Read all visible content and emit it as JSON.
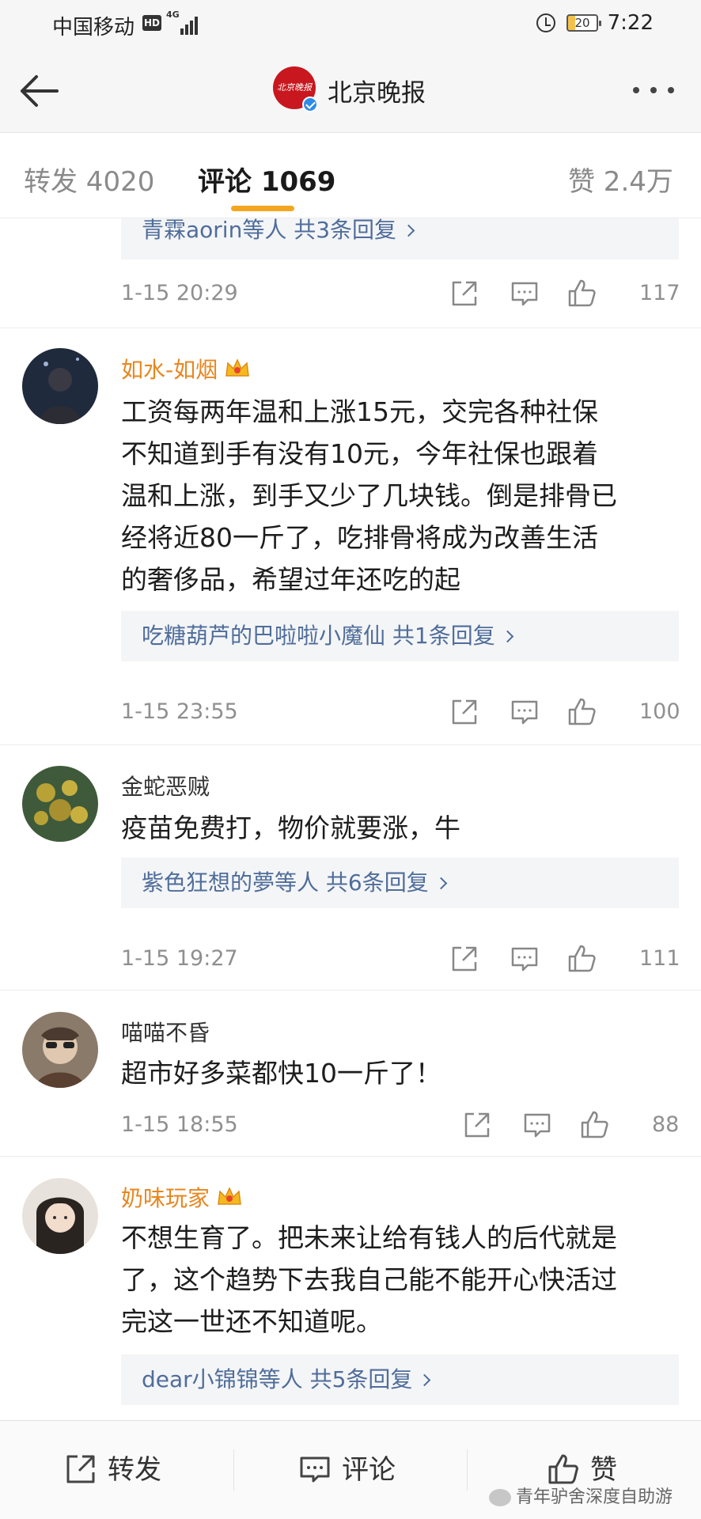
{
  "status_bar": {
    "carrier": "中国移动",
    "hd": "HD",
    "network": "4G",
    "battery": "20",
    "time": "7:22"
  },
  "header": {
    "logo_text": "北京晚报",
    "account_name": "北京晚报",
    "more_icon": "more-dots-icon",
    "back_icon": "arrow-left-icon"
  },
  "tabs": {
    "repost": "转发 4020",
    "comments": "评论 1069",
    "likes": "赞 2.4万"
  },
  "colors": {
    "accent": "#f4a621",
    "link": "#4f6d9a",
    "vip_name": "#e8861e",
    "brand_red": "#c8171e"
  },
  "feed": {
    "top": {
      "reply_summary": "青霖aorin等人  共3条回复",
      "time": "1-15 20:29",
      "likes": "117"
    },
    "comments": [
      {
        "username": "如水-如烟",
        "vip": true,
        "text": "工资每两年温和上涨15元，交完各种社保\n不知道到手有没有10元，今年社保也跟着\n温和上涨，到手又少了几块钱。倒是排骨已\n经将近80一斤了，吃排骨将成为改善生活\n的奢侈品，希望过年还吃的起",
        "reply_summary": "吃糖葫芦的巴啦啦小魔仙  共1条回复",
        "time": "1-15 23:55",
        "likes": "100"
      },
      {
        "username": "金蛇恶贼",
        "vip": false,
        "text": "疫苗免费打，物价就要涨，牛",
        "reply_summary": "紫色狂想的夢等人  共6条回复",
        "time": "1-15 19:27",
        "likes": "111"
      },
      {
        "username": "喵喵不昏",
        "vip": false,
        "text": "超市好多菜都快10一斤了！",
        "time": "1-15 18:55",
        "likes": "88"
      },
      {
        "username": "奶味玩家",
        "vip": true,
        "text": "不想生育了。把未来让给有钱人的后代就是\n了，这个趋势下去我自己能不能开心快活过\n完这一世还不知道呢。",
        "reply_summary": "dear小锦锦等人  共5条回复"
      }
    ]
  },
  "bottom_bar": {
    "repost": "转发",
    "comment": "评论",
    "like": "赞",
    "watermark": "青年驴舍深度自助游"
  }
}
